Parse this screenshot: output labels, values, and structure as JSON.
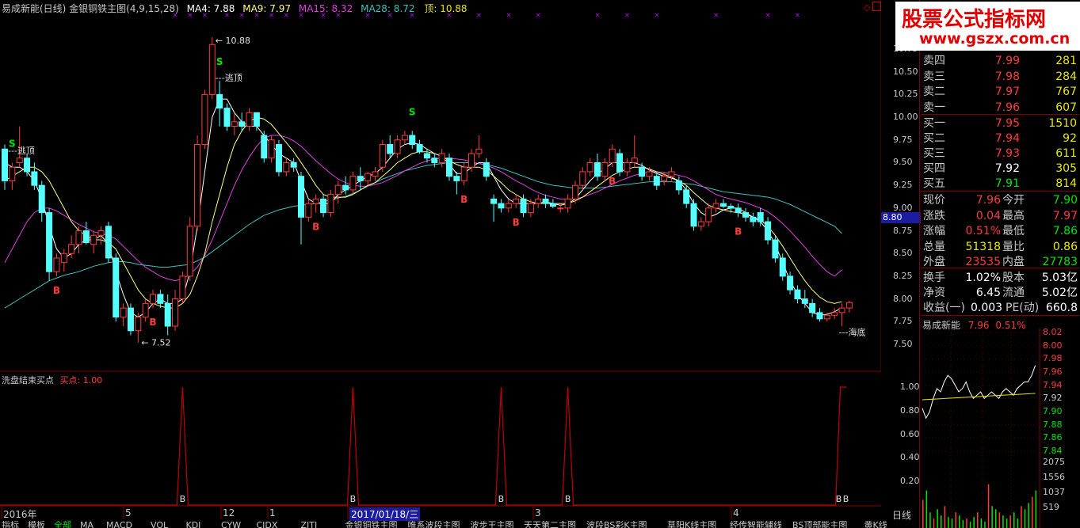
{
  "header": {
    "title": "易成新能(日线) 金银铜铁主图(4,9,15,28)",
    "ma4": "MA4: 7.88",
    "ma9": "MA9: 7.97",
    "ma15": "MA15: 8.32",
    "ma28": "MA28: 8.72",
    "top": "顶: 10.88"
  },
  "watermark": {
    "line1": "股票公式指标网",
    "line2": "www.gszx.com.cn"
  },
  "price_axis": {
    "ticks": [
      "10.75",
      "10.50",
      "10.25",
      "10.00",
      "9.75",
      "9.50",
      "9.25",
      "9.00",
      "8.75",
      "8.50",
      "8.25",
      "8.00",
      "7.75",
      "7.50"
    ],
    "current": "8.80"
  },
  "annotations": {
    "top_label": "10.88",
    "escape1": "---逃顶",
    "escape2": "---逃顶",
    "low_label": "7.52",
    "bottom_label": "---海底",
    "buy": "B",
    "sell": "S"
  },
  "indicator": {
    "title": "洗盘结束买点",
    "value": "买点: 1.00",
    "axis": [
      "1.00",
      "0.80",
      "0.60",
      "0.40",
      "0.20"
    ],
    "buy": "B"
  },
  "date_axis": [
    "2016年",
    "5",
    "12",
    "1",
    "2017/01/18/三",
    "3",
    "4"
  ],
  "right_label": "日线",
  "order_book": {
    "asks": [
      {
        "label": "卖五",
        "price": "8.00",
        "vol": "317"
      },
      {
        "label": "卖四",
        "price": "7.99",
        "vol": "281"
      },
      {
        "label": "卖三",
        "price": "7.98",
        "vol": "284"
      },
      {
        "label": "卖二",
        "price": "7.97",
        "vol": "767"
      },
      {
        "label": "卖一",
        "price": "7.96",
        "vol": "607"
      }
    ],
    "bids": [
      {
        "label": "买一",
        "price": "7.95",
        "vol": "1510"
      },
      {
        "label": "买二",
        "price": "7.94",
        "vol": "92"
      },
      {
        "label": "买三",
        "price": "7.93",
        "vol": "611"
      },
      {
        "label": "买四",
        "price": "7.92",
        "vol": "305"
      },
      {
        "label": "买五",
        "price": "7.91",
        "vol": "814"
      }
    ]
  },
  "stats": [
    {
      "l1": "现价",
      "v1": "7.96",
      "c1": "red",
      "l2": "今开",
      "v2": "7.90",
      "c2": "green"
    },
    {
      "l1": "涨跌",
      "v1": "0.04",
      "c1": "red",
      "l2": "最高",
      "v2": "7.97",
      "c2": "red"
    },
    {
      "l1": "涨幅",
      "v1": "0.51%",
      "c1": "red",
      "l2": "最低",
      "v2": "7.86",
      "c2": "green"
    },
    {
      "l1": "总量",
      "v1": "51318",
      "c1": "yellow",
      "l2": "量比",
      "v2": "0.86",
      "c2": "yellow"
    },
    {
      "l1": "外盘",
      "v1": "23535",
      "c1": "red",
      "l2": "内盘",
      "v2": "27783",
      "c2": "green"
    },
    {
      "l1": "换手",
      "v1": "1.02%",
      "c1": "white",
      "l2": "股本",
      "v2": "5.03亿",
      "c2": "white"
    },
    {
      "l1": "净资",
      "v1": "6.45",
      "c1": "white",
      "l2": "流通",
      "v2": "5.02亿",
      "c2": "white"
    },
    {
      "l1": "收益(一)",
      "v1": "0.003",
      "c1": "white",
      "l2": "PE(动)",
      "v2": "660.8",
      "c2": "white"
    }
  ],
  "mini": {
    "name": "易成新能",
    "price": "7.96",
    "pct": "0.51%",
    "axis": [
      "8.02",
      "8.00",
      "7.98",
      "7.96",
      "7.94",
      "7.92",
      "7.90",
      "7.88",
      "7.86",
      "7.84"
    ],
    "vol_axis": [
      "2075",
      "1556",
      "1037",
      "519"
    ]
  },
  "tabs": [
    "指标",
    "模板",
    "全部",
    "MA",
    "MACD",
    "VOL",
    "KDJ",
    "CYW",
    "CJDX",
    "ZJTJ",
    "金银铜铁主图",
    "唯系波段主图",
    "波步王主图",
    "天天第二主图",
    "波段BS彩K主图",
    "草阳K线主图",
    "经传智能辅线",
    "BS顶部能主图",
    "黄K线BS点主图",
    "草莓波段主图"
  ],
  "colors": {
    "up": "#ff3c3c",
    "down": "#54ffff",
    "ma4": "#ffffff",
    "ma9": "#ffff80",
    "ma15": "#e040e0",
    "ma28": "#40c0c0",
    "grid": "#800000",
    "indicator": "#c00000"
  },
  "candles": [
    {
      "o": 9.65,
      "h": 9.7,
      "l": 9.2,
      "c": 9.3
    },
    {
      "o": 9.3,
      "h": 9.5,
      "l": 9.2,
      "c": 9.45
    },
    {
      "o": 9.5,
      "h": 9.9,
      "l": 9.45,
      "c": 9.55
    },
    {
      "o": 9.55,
      "h": 9.6,
      "l": 9.35,
      "c": 9.4
    },
    {
      "o": 9.4,
      "h": 9.5,
      "l": 9.2,
      "c": 9.25
    },
    {
      "o": 9.25,
      "h": 9.3,
      "l": 8.85,
      "c": 8.95
    },
    {
      "o": 8.95,
      "h": 9.0,
      "l": 8.2,
      "c": 8.3
    },
    {
      "o": 8.3,
      "h": 8.5,
      "l": 8.25,
      "c": 8.45
    },
    {
      "o": 8.4,
      "h": 8.55,
      "l": 8.3,
      "c": 8.5
    },
    {
      "o": 8.5,
      "h": 8.7,
      "l": 8.45,
      "c": 8.6
    },
    {
      "o": 8.6,
      "h": 8.8,
      "l": 8.5,
      "c": 8.75
    },
    {
      "o": 8.75,
      "h": 8.85,
      "l": 8.6,
      "c": 8.62
    },
    {
      "o": 8.6,
      "h": 8.75,
      "l": 8.5,
      "c": 8.7
    },
    {
      "o": 8.7,
      "h": 8.8,
      "l": 8.6,
      "c": 8.75
    },
    {
      "o": 8.8,
      "h": 8.85,
      "l": 8.4,
      "c": 8.45
    },
    {
      "o": 8.45,
      "h": 8.5,
      "l": 7.75,
      "c": 7.8
    },
    {
      "o": 7.8,
      "h": 7.95,
      "l": 7.7,
      "c": 7.9
    },
    {
      "o": 7.9,
      "h": 7.95,
      "l": 7.6,
      "c": 7.65
    },
    {
      "o": 7.65,
      "h": 7.85,
      "l": 7.52,
      "c": 7.8
    },
    {
      "o": 7.8,
      "h": 8.0,
      "l": 7.75,
      "c": 7.95
    },
    {
      "o": 7.95,
      "h": 8.1,
      "l": 7.9,
      "c": 8.05
    },
    {
      "o": 8.05,
      "h": 8.1,
      "l": 7.9,
      "c": 7.95
    },
    {
      "o": 7.95,
      "h": 8.05,
      "l": 7.6,
      "c": 7.7
    },
    {
      "o": 7.7,
      "h": 8.1,
      "l": 7.65,
      "c": 8.0
    },
    {
      "o": 8.0,
      "h": 8.3,
      "l": 7.95,
      "c": 8.25
    },
    {
      "o": 8.25,
      "h": 8.9,
      "l": 8.2,
      "c": 8.8
    },
    {
      "o": 8.8,
      "h": 9.8,
      "l": 8.75,
      "c": 9.7
    },
    {
      "o": 9.7,
      "h": 10.3,
      "l": 9.65,
      "c": 10.25
    },
    {
      "o": 10.25,
      "h": 10.88,
      "l": 10.2,
      "c": 10.8
    },
    {
      "o": 10.25,
      "h": 10.4,
      "l": 9.9,
      "c": 10.1
    },
    {
      "o": 10.1,
      "h": 10.15,
      "l": 9.85,
      "c": 9.9
    },
    {
      "o": 9.9,
      "h": 10.05,
      "l": 9.8,
      "c": 9.95
    },
    {
      "o": 9.95,
      "h": 10.05,
      "l": 9.85,
      "c": 9.9
    },
    {
      "o": 9.9,
      "h": 10.1,
      "l": 9.85,
      "c": 10.05
    },
    {
      "o": 10.05,
      "h": 10.05,
      "l": 9.85,
      "c": 9.9
    },
    {
      "o": 9.8,
      "h": 9.85,
      "l": 9.5,
      "c": 9.55
    },
    {
      "o": 9.55,
      "h": 9.8,
      "l": 9.5,
      "c": 9.75
    },
    {
      "o": 9.7,
      "h": 9.75,
      "l": 9.35,
      "c": 9.4
    },
    {
      "o": 9.4,
      "h": 9.55,
      "l": 9.35,
      "c": 9.5
    },
    {
      "o": 9.5,
      "h": 9.55,
      "l": 9.4,
      "c": 9.45
    },
    {
      "o": 9.35,
      "h": 9.4,
      "l": 8.6,
      "c": 8.9
    },
    {
      "o": 8.9,
      "h": 9.1,
      "l": 8.85,
      "c": 9.05
    },
    {
      "o": 9.05,
      "h": 9.15,
      "l": 8.95,
      "c": 9.1
    },
    {
      "o": 9.1,
      "h": 9.15,
      "l": 8.9,
      "c": 8.95
    },
    {
      "o": 8.95,
      "h": 9.2,
      "l": 8.9,
      "c": 9.15
    },
    {
      "o": 9.15,
      "h": 9.3,
      "l": 9.05,
      "c": 9.25
    },
    {
      "o": 9.25,
      "h": 9.35,
      "l": 9.15,
      "c": 9.2
    },
    {
      "o": 9.2,
      "h": 9.4,
      "l": 9.15,
      "c": 9.35
    },
    {
      "o": 9.35,
      "h": 9.45,
      "l": 9.2,
      "c": 9.3
    },
    {
      "o": 9.3,
      "h": 9.4,
      "l": 9.25,
      "c": 9.38
    },
    {
      "o": 9.35,
      "h": 9.45,
      "l": 9.3,
      "c": 9.4
    },
    {
      "o": 9.45,
      "h": 9.75,
      "l": 9.4,
      "c": 9.7
    },
    {
      "o": 9.7,
      "h": 9.8,
      "l": 9.55,
      "c": 9.6
    },
    {
      "o": 9.6,
      "h": 9.8,
      "l": 9.55,
      "c": 9.75
    },
    {
      "o": 9.75,
      "h": 9.85,
      "l": 9.7,
      "c": 9.8
    },
    {
      "o": 9.8,
      "h": 9.85,
      "l": 9.65,
      "c": 9.7
    },
    {
      "o": 9.7,
      "h": 9.75,
      "l": 9.6,
      "c": 9.62
    },
    {
      "o": 9.6,
      "h": 9.65,
      "l": 9.5,
      "c": 9.55
    },
    {
      "o": 9.55,
      "h": 9.6,
      "l": 9.45,
      "c": 9.5
    },
    {
      "o": 9.5,
      "h": 9.65,
      "l": 9.45,
      "c": 9.6
    },
    {
      "o": 9.55,
      "h": 9.6,
      "l": 9.3,
      "c": 9.35
    },
    {
      "o": 9.35,
      "h": 9.4,
      "l": 9.15,
      "c": 9.3
    },
    {
      "o": 9.3,
      "h": 9.5,
      "l": 9.25,
      "c": 9.45
    },
    {
      "o": 9.45,
      "h": 9.65,
      "l": 9.4,
      "c": 9.6
    },
    {
      "o": 9.6,
      "h": 9.8,
      "l": 9.55,
      "c": 9.65
    },
    {
      "o": 9.5,
      "h": 9.55,
      "l": 9.3,
      "c": 9.35
    },
    {
      "o": 9.1,
      "h": 9.15,
      "l": 8.85,
      "c": 9.05
    },
    {
      "o": 9.05,
      "h": 9.1,
      "l": 8.95,
      "c": 9.0
    },
    {
      "o": 9.0,
      "h": 9.1,
      "l": 8.95,
      "c": 9.05
    },
    {
      "o": 9.05,
      "h": 9.15,
      "l": 9.0,
      "c": 9.1
    },
    {
      "o": 9.1,
      "h": 9.15,
      "l": 8.9,
      "c": 8.95
    },
    {
      "o": 8.95,
      "h": 9.1,
      "l": 8.9,
      "c": 9.05
    },
    {
      "o": 9.05,
      "h": 9.15,
      "l": 9.0,
      "c": 9.1
    },
    {
      "o": 9.1,
      "h": 9.15,
      "l": 9.0,
      "c": 9.05
    },
    {
      "o": 9.05,
      "h": 9.1,
      "l": 9.0,
      "c": 9.02
    },
    {
      "o": 9.0,
      "h": 9.05,
      "l": 8.95,
      "c": 9.0
    },
    {
      "o": 9.0,
      "h": 9.15,
      "l": 8.95,
      "c": 9.1
    },
    {
      "o": 9.1,
      "h": 9.3,
      "l": 9.05,
      "c": 9.25
    },
    {
      "o": 9.25,
      "h": 9.45,
      "l": 9.2,
      "c": 9.4
    },
    {
      "o": 9.4,
      "h": 9.55,
      "l": 9.35,
      "c": 9.5
    },
    {
      "o": 9.5,
      "h": 9.6,
      "l": 9.3,
      "c": 9.35
    },
    {
      "o": 9.35,
      "h": 9.55,
      "l": 9.3,
      "c": 9.5
    },
    {
      "o": 9.5,
      "h": 9.7,
      "l": 9.45,
      "c": 9.65
    },
    {
      "o": 9.6,
      "h": 9.65,
      "l": 9.35,
      "c": 9.4
    },
    {
      "o": 9.4,
      "h": 9.55,
      "l": 9.35,
      "c": 9.5
    },
    {
      "o": 9.5,
      "h": 9.8,
      "l": 9.45,
      "c": 9.55
    },
    {
      "o": 9.45,
      "h": 9.5,
      "l": 9.3,
      "c": 9.35
    },
    {
      "o": 9.35,
      "h": 9.45,
      "l": 9.3,
      "c": 9.4
    },
    {
      "o": 9.35,
      "h": 9.4,
      "l": 9.2,
      "c": 9.25
    },
    {
      "o": 9.3,
      "h": 9.4,
      "l": 9.25,
      "c": 9.35
    },
    {
      "o": 9.35,
      "h": 9.45,
      "l": 9.3,
      "c": 9.4
    },
    {
      "o": 9.3,
      "h": 9.35,
      "l": 9.15,
      "c": 9.2
    },
    {
      "o": 9.2,
      "h": 9.25,
      "l": 9.0,
      "c": 9.05
    },
    {
      "o": 9.05,
      "h": 9.1,
      "l": 8.75,
      "c": 8.8
    },
    {
      "o": 8.8,
      "h": 8.9,
      "l": 8.75,
      "c": 8.85
    },
    {
      "o": 8.85,
      "h": 9.05,
      "l": 8.8,
      "c": 9.0
    },
    {
      "o": 9.0,
      "h": 9.1,
      "l": 8.95,
      "c": 9.05
    },
    {
      "o": 9.05,
      "h": 9.1,
      "l": 9.0,
      "c": 9.02
    },
    {
      "o": 9.02,
      "h": 9.05,
      "l": 8.95,
      "c": 9.0
    },
    {
      "o": 9.0,
      "h": 9.05,
      "l": 8.9,
      "c": 8.95
    },
    {
      "o": 8.95,
      "h": 9.0,
      "l": 8.85,
      "c": 8.9
    },
    {
      "o": 8.9,
      "h": 8.95,
      "l": 8.8,
      "c": 8.85
    },
    {
      "o": 8.95,
      "h": 9.0,
      "l": 8.8,
      "c": 8.85
    },
    {
      "o": 8.85,
      "h": 8.9,
      "l": 8.6,
      "c": 8.65
    },
    {
      "o": 8.65,
      "h": 8.7,
      "l": 8.4,
      "c": 8.45
    },
    {
      "o": 8.45,
      "h": 8.5,
      "l": 8.2,
      "c": 8.25
    },
    {
      "o": 8.25,
      "h": 8.3,
      "l": 8.05,
      "c": 8.1
    },
    {
      "o": 8.1,
      "h": 8.15,
      "l": 7.95,
      "c": 8.0
    },
    {
      "o": 8.0,
      "h": 8.1,
      "l": 7.9,
      "c": 7.95
    },
    {
      "o": 7.95,
      "h": 8.0,
      "l": 7.8,
      "c": 7.85
    },
    {
      "o": 7.85,
      "h": 7.9,
      "l": 7.75,
      "c": 7.78
    },
    {
      "o": 7.78,
      "h": 7.85,
      "l": 7.75,
      "c": 7.82
    },
    {
      "o": 7.82,
      "h": 7.9,
      "l": 7.78,
      "c": 7.85
    },
    {
      "o": 7.85,
      "h": 7.95,
      "l": 7.7,
      "c": 7.9
    },
    {
      "o": 7.9,
      "h": 7.98,
      "l": 7.85,
      "c": 7.96
    }
  ],
  "ma_lines": {
    "ma4": [
      9.5,
      9.45,
      9.45,
      9.4,
      9.3,
      9.1,
      8.8,
      8.55,
      8.45,
      8.5,
      8.6,
      8.65,
      8.65,
      8.7,
      8.6,
      8.3,
      8.05,
      7.85,
      7.8,
      7.85,
      7.95,
      8.0,
      7.95,
      7.95,
      8.0,
      8.3,
      8.8,
      9.4,
      10.0,
      10.2,
      10.2,
      10.05,
      9.95,
      9.9,
      9.9,
      9.8,
      9.7,
      9.6,
      9.55,
      9.5,
      9.3,
      9.1,
      9.05,
      9.05,
      9.05,
      9.15,
      9.2,
      9.25,
      9.3,
      9.35,
      9.38,
      9.45,
      9.55,
      9.65,
      9.7,
      9.72,
      9.7,
      9.65,
      9.6,
      9.57,
      9.48,
      9.38,
      9.38,
      9.45,
      9.5,
      9.5,
      9.35,
      9.2,
      9.1,
      9.05,
      9.05,
      9.05,
      9.05,
      9.07,
      9.05,
      9.03,
      9.05,
      9.1,
      9.2,
      9.3,
      9.38,
      9.43,
      9.5,
      9.5,
      9.5,
      9.5,
      9.47,
      9.42,
      9.38,
      9.35,
      9.33,
      9.3,
      9.2,
      9.05,
      8.95,
      8.9,
      8.93,
      8.98,
      9.0,
      9.0,
      8.95,
      8.9,
      8.85,
      8.75,
      8.6,
      8.4,
      8.2,
      8.05,
      7.95,
      7.85,
      7.82,
      7.83,
      7.86,
      7.9
    ],
    "ma9": [
      9.3,
      9.35,
      9.4,
      9.45,
      9.45,
      9.4,
      9.3,
      9.15,
      9.0,
      8.85,
      8.75,
      8.7,
      8.65,
      8.65,
      8.62,
      8.55,
      8.4,
      8.25,
      8.1,
      8.0,
      7.95,
      7.92,
      7.9,
      7.9,
      7.95,
      8.05,
      8.25,
      8.5,
      8.85,
      9.15,
      9.45,
      9.7,
      9.85,
      9.95,
      10.0,
      9.98,
      9.92,
      9.82,
      9.72,
      9.62,
      9.5,
      9.38,
      9.25,
      9.15,
      9.12,
      9.12,
      9.12,
      9.15,
      9.2,
      9.25,
      9.28,
      9.35,
      9.42,
      9.5,
      9.55,
      9.6,
      9.62,
      9.62,
      9.6,
      9.57,
      9.52,
      9.48,
      9.45,
      9.45,
      9.45,
      9.42,
      9.35,
      9.28,
      9.2,
      9.15,
      9.1,
      9.07,
      9.05,
      9.05,
      9.05,
      9.05,
      9.05,
      9.08,
      9.12,
      9.18,
      9.24,
      9.3,
      9.36,
      9.4,
      9.43,
      9.45,
      9.45,
      9.43,
      9.4,
      9.37,
      9.34,
      9.3,
      9.25,
      9.17,
      9.1,
      9.03,
      9.0,
      8.98,
      8.96,
      8.95,
      8.93,
      8.9,
      8.87,
      8.8,
      8.7,
      8.58,
      8.45,
      8.32,
      8.2,
      8.1,
      8.02,
      7.97,
      7.95,
      7.97
    ]
  },
  "ma15": [
    8.4,
    8.55,
    8.7,
    8.85,
    8.95,
    9.0,
    9.0,
    8.97,
    8.92,
    8.87,
    8.82,
    8.78,
    8.74,
    8.72,
    8.7,
    8.66,
    8.58,
    8.5,
    8.42,
    8.35,
    8.3,
    8.25,
    8.22,
    8.2,
    8.22,
    8.27,
    8.35,
    8.48,
    8.65,
    8.85,
    9.05,
    9.25,
    9.42,
    9.56,
    9.68,
    9.77,
    9.8,
    9.8,
    9.78,
    9.74,
    9.68,
    9.6,
    9.52,
    9.45,
    9.38,
    9.32,
    9.28,
    9.25,
    9.24,
    9.24,
    9.26,
    9.28,
    9.32,
    9.36,
    9.41,
    9.45,
    9.49,
    9.52,
    9.54,
    9.55,
    9.55,
    9.54,
    9.53,
    9.51,
    9.49,
    9.47,
    9.44,
    9.4,
    9.35,
    9.3,
    9.26,
    9.21,
    9.17,
    9.14,
    9.12,
    9.1,
    9.1,
    9.1,
    9.12,
    9.15,
    9.18,
    9.22,
    9.26,
    9.3,
    9.33,
    9.36,
    9.38,
    9.4,
    9.4,
    9.39,
    9.38,
    9.36,
    9.34,
    9.3,
    9.25,
    9.2,
    9.15,
    9.12,
    9.1,
    9.08,
    9.06,
    9.03,
    9.0,
    8.96,
    8.9,
    8.83,
    8.75,
    8.66,
    8.57,
    8.47,
    8.38,
    8.3,
    8.25,
    8.32
  ],
  "ma28": [
    7.9,
    7.95,
    8.0,
    8.05,
    8.1,
    8.15,
    8.2,
    8.23,
    8.26,
    8.28,
    8.3,
    8.33,
    8.36,
    8.38,
    8.4,
    8.41,
    8.41,
    8.4,
    8.38,
    8.37,
    8.36,
    8.35,
    8.35,
    8.36,
    8.37,
    8.38,
    8.42,
    8.46,
    8.52,
    8.58,
    8.64,
    8.7,
    8.76,
    8.82,
    8.87,
    8.92,
    8.95,
    8.98,
    9.0,
    9.02,
    9.03,
    9.04,
    9.05,
    9.07,
    9.09,
    9.11,
    9.13,
    9.16,
    9.2,
    9.24,
    9.28,
    9.32,
    9.35,
    9.38,
    9.41,
    9.43,
    9.45,
    9.47,
    9.48,
    9.49,
    9.5,
    9.5,
    9.5,
    9.5,
    9.49,
    9.48,
    9.46,
    9.44,
    9.41,
    9.38,
    9.35,
    9.32,
    9.29,
    9.27,
    9.25,
    9.24,
    9.23,
    9.22,
    9.22,
    9.22,
    9.22,
    9.23,
    9.24,
    9.25,
    9.26,
    9.27,
    9.28,
    9.29,
    9.29,
    9.29,
    9.29,
    9.28,
    9.27,
    9.26,
    9.24,
    9.22,
    9.2,
    9.18,
    9.17,
    9.16,
    9.15,
    9.14,
    9.13,
    9.12,
    9.1,
    9.07,
    9.04,
    9.0,
    8.96,
    8.92,
    8.88,
    8.84,
    8.8,
    8.72
  ],
  "buy_signals": [
    7,
    20,
    42,
    62,
    69,
    82,
    99
  ],
  "sell_signals": [
    1,
    29,
    55
  ],
  "indicator_peaks": [
    18,
    34,
    49,
    56,
    85
  ]
}
